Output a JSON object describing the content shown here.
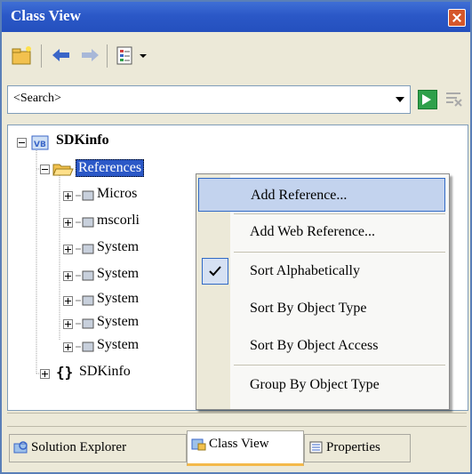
{
  "window": {
    "title": "Class View"
  },
  "search": {
    "value": "<Search>"
  },
  "tree": {
    "root": "SDKinfo",
    "references": "References",
    "children": [
      "Micros",
      "mscorli",
      "System",
      "System",
      "System",
      "System",
      "System"
    ],
    "namespace_brace": "{}",
    "namespace": "SDKinfo"
  },
  "context_menu": {
    "items": [
      "Add Reference...",
      "Add Web Reference...",
      "Sort Alphabetically",
      "Sort By Object Type",
      "Sort By Object Access",
      "Group By Object Type"
    ]
  },
  "tabs": [
    "Solution Explorer",
    "Class View",
    "Properties"
  ],
  "colors": {
    "title_bar": "#2b58c7",
    "highlight": "#c3d3ee",
    "active_tab_accent": "#f4b94a"
  }
}
